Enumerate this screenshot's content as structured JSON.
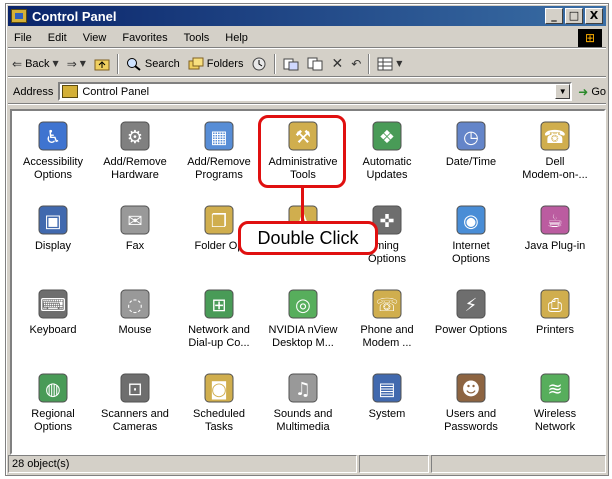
{
  "window": {
    "title": "Control Panel",
    "controls": {
      "minimize": "_",
      "maximize": "□",
      "close": "X"
    }
  },
  "menubar": {
    "items": [
      "File",
      "Edit",
      "View",
      "Favorites",
      "Tools",
      "Help"
    ]
  },
  "toolbar": {
    "back": "Back",
    "search": "Search",
    "folders": "Folders"
  },
  "address": {
    "label": "Address",
    "value": "Control Panel",
    "go": "Go"
  },
  "items": [
    {
      "line1": "Accessibility",
      "line2": "Options",
      "icon": "accessibility-icon"
    },
    {
      "line1": "Add/Remove",
      "line2": "Hardware",
      "icon": "add-remove-hardware-icon"
    },
    {
      "line1": "Add/Remove",
      "line2": "Programs",
      "icon": "add-remove-programs-icon"
    },
    {
      "line1": "Administrative",
      "line2": "Tools",
      "icon": "administrative-tools-icon"
    },
    {
      "line1": "Automatic",
      "line2": "Updates",
      "icon": "automatic-updates-icon"
    },
    {
      "line1": "Date/Time",
      "line2": "",
      "icon": "date-time-icon"
    },
    {
      "line1": "Dell",
      "line2": "Modem-on-...",
      "icon": "dell-modem-icon"
    },
    {
      "line1": "Display",
      "line2": "",
      "icon": "display-icon"
    },
    {
      "line1": "Fax",
      "line2": "",
      "icon": "fax-icon"
    },
    {
      "line1": "Folder Op",
      "line2": "",
      "icon": "folder-options-icon"
    },
    {
      "line1": "",
      "line2": "",
      "icon": "fonts-icon"
    },
    {
      "line1": "ming",
      "line2": "Options",
      "icon": "gaming-options-icon"
    },
    {
      "line1": "Internet",
      "line2": "Options",
      "icon": "internet-options-icon"
    },
    {
      "line1": "Java Plug-in",
      "line2": "",
      "icon": "java-plugin-icon"
    },
    {
      "line1": "Keyboard",
      "line2": "",
      "icon": "keyboard-icon"
    },
    {
      "line1": "Mouse",
      "line2": "",
      "icon": "mouse-icon"
    },
    {
      "line1": "Network and",
      "line2": "Dial-up Co...",
      "icon": "network-icon"
    },
    {
      "line1": "NVIDIA nView",
      "line2": "Desktop M...",
      "icon": "nvidia-icon"
    },
    {
      "line1": "Phone and",
      "line2": "Modem ...",
      "icon": "phone-modem-icon"
    },
    {
      "line1": "Power Options",
      "line2": "",
      "icon": "power-options-icon"
    },
    {
      "line1": "Printers",
      "line2": "",
      "icon": "printers-icon"
    },
    {
      "line1": "Regional",
      "line2": "Options",
      "icon": "regional-options-icon"
    },
    {
      "line1": "Scanners and",
      "line2": "Cameras",
      "icon": "scanners-cameras-icon"
    },
    {
      "line1": "Scheduled",
      "line2": "Tasks",
      "icon": "scheduled-tasks-icon"
    },
    {
      "line1": "Sounds and",
      "line2": "Multimedia",
      "icon": "sounds-icon"
    },
    {
      "line1": "System",
      "line2": "",
      "icon": "system-icon"
    },
    {
      "line1": "Users and",
      "line2": "Passwords",
      "icon": "users-passwords-icon"
    },
    {
      "line1": "Wireless",
      "line2": "Network",
      "icon": "wireless-network-icon"
    }
  ],
  "callout": {
    "text": "Double Click"
  },
  "status": {
    "count": "28 object(s)"
  },
  "colors": {
    "titlebar": "#0a246a",
    "callout_border": "#e01010",
    "face": "#d4d0c8"
  }
}
